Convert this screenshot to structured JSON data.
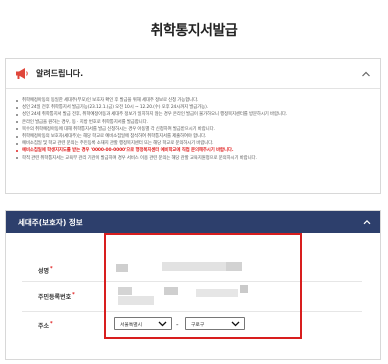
{
  "page": {
    "title": "취학통지서발급"
  },
  "notice": {
    "title": "알려드립니다.",
    "items": [
      {
        "text": "취학예정아동의 동일한 세대주(부모)인 보호자 확인 후 발급을 위해 세대주 정보로 신청 가능합니다.",
        "red": false
      },
      {
        "text": "성인 24일 전후 취학통지서 발급가능(23.12.1.(금) 오전 10시 ~ 12.20.(수) 오후 24시까지 발급가능).",
        "red": false
      },
      {
        "text": "성인 24세 취학통지서 발급 전후, 취학예정아동과 세대주 정보가 일치하지 않는 경우 온라인 발급이 불가하오니 행정복지센터를 방문하시기 바랍니다.",
        "red": false
      },
      {
        "text": "온라인 발급을 원하는 경우, 동 · 지방 번호로 취학통지서를 발급합니다.",
        "red": false
      },
      {
        "text": "복수의 취학예정아동에 대해 취학통지서를 발급 신청하시는 경우 아동별 각 신청하여 발급받으시기 바랍니다.",
        "red": false
      },
      {
        "text": "취학예정아동의 보호자(세대주)는 해당 학교로 예비소집일에 참석하여 취학통지서를 제출하여야 합니다.",
        "red": false
      },
      {
        "text": "예비소집일 및 학교 관련 문의는 주민등록 소재지 관할 행정복지센터 또는 해당 학교로 문의하시기 바랍니다.",
        "red": false
      },
      {
        "text": "예비소집일에 학생지지도를 받는 경우 '0000-00-0000'으로 행정복지센터 예비학교에 직접 문의해주시기 바랍니다.",
        "red": true
      },
      {
        "text": "학적 관련 취학통지서는 교육부 관리 기관이 발급하며 경우 서비스 이용 관련 문의는 해당 관할 교육지원청으로 문의하시기 바랍니다.",
        "red": false
      }
    ]
  },
  "guardian": {
    "section_title": "세대주(보호자) 정보",
    "name_label": "성명",
    "rrn_label": "주민등록번호",
    "address_label": "주소",
    "required_mark": "*",
    "sido_value": "서울특별시",
    "sigungu_value": "구로구",
    "dash": "-"
  },
  "colors": {
    "header_bg": "#2d3f6c",
    "highlight": "#d81e1e",
    "required": "#e02020"
  },
  "icons": {
    "notice": "megaphone-icon",
    "collapse": "chevron-up-icon",
    "select": "chevron-down-icon"
  }
}
